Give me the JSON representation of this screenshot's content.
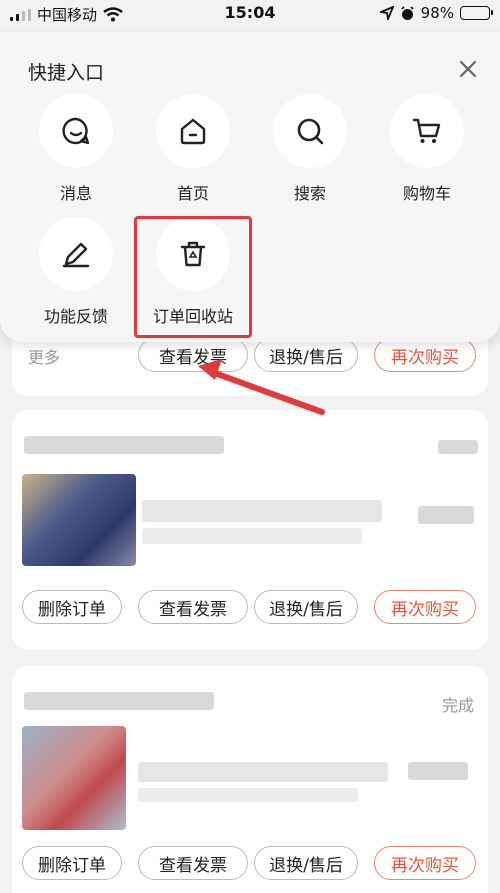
{
  "status_bar": {
    "carrier": "中国移动",
    "time": "15:04",
    "battery": "98%"
  },
  "quick_entry": {
    "title": "快捷入口",
    "items": [
      {
        "label": "消息",
        "icon": "message-icon"
      },
      {
        "label": "首页",
        "icon": "home-icon"
      },
      {
        "label": "搜索",
        "icon": "search-icon"
      },
      {
        "label": "购物车",
        "icon": "cart-icon"
      },
      {
        "label": "功能反馈",
        "icon": "pencil-icon"
      },
      {
        "label": "订单回收站",
        "icon": "trash-icon"
      }
    ]
  },
  "orders": {
    "card1": {
      "more": "更多",
      "invoice": "查看发票",
      "return": "退换/售后",
      "rebuy": "再次购买"
    },
    "card2": {
      "delete": "删除订单",
      "invoice": "查看发票",
      "return": "退换/售后",
      "rebuy": "再次购买"
    },
    "card3": {
      "status": "完成",
      "delete": "删除订单",
      "invoice": "查看发票",
      "return": "退换/售后",
      "rebuy": "再次购买"
    }
  },
  "colors": {
    "highlight": "#e23a3a",
    "rebuy": "#e05a3c"
  }
}
